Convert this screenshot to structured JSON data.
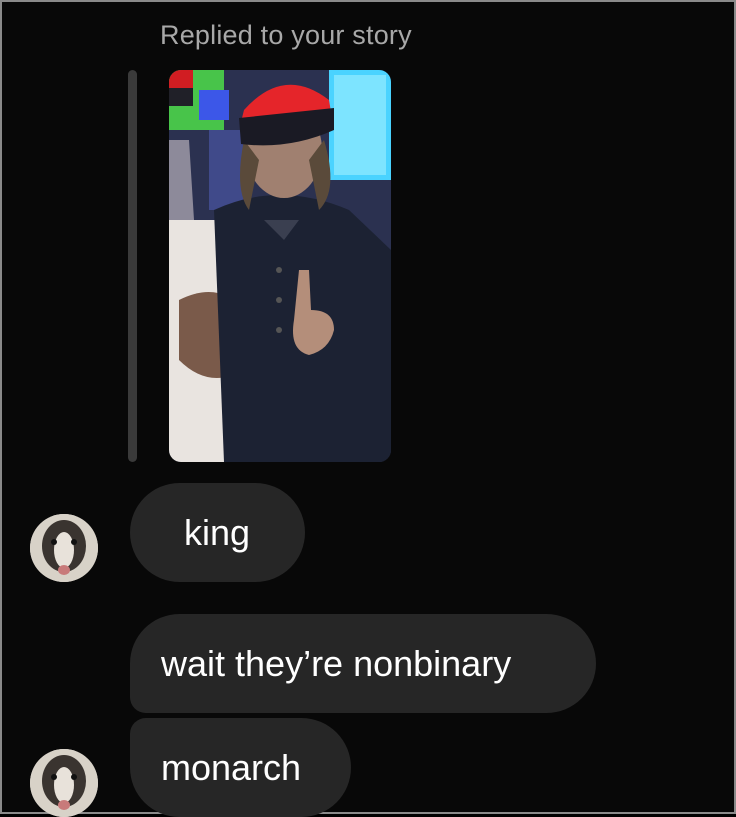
{
  "story_reply": {
    "caption": "Replied to your story",
    "thumbnail_icon": "story-photo-thumbnail"
  },
  "messages": [
    {
      "text": "king",
      "show_avatar": true
    },
    {
      "text": "wait they’re nonbinary",
      "show_avatar": false
    },
    {
      "text": "monarch",
      "show_avatar": true
    }
  ],
  "colors": {
    "background": "#000000",
    "bubble": "#262626",
    "caption": "#a8a8a8",
    "text": "#ffffff"
  }
}
